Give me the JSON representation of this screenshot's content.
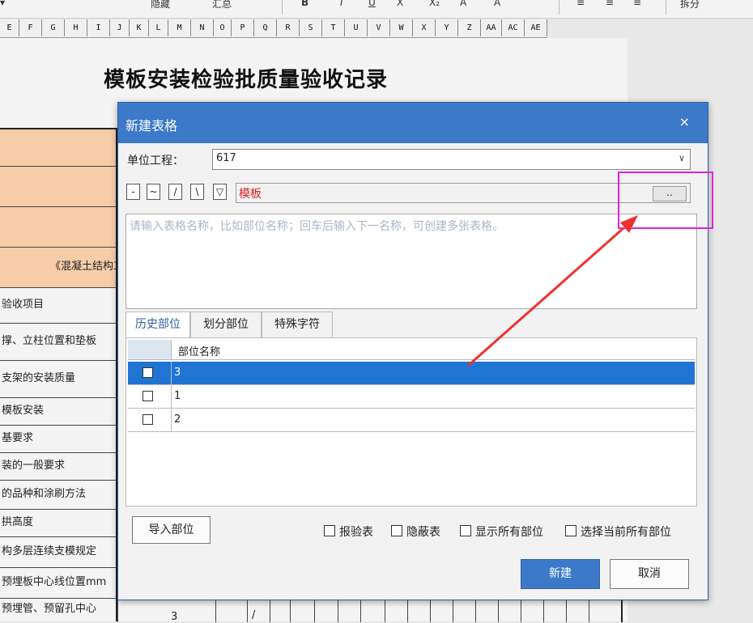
{
  "toolbar": {
    "items": [
      "隐藏",
      "汇总",
      "B",
      "I",
      "U",
      "X",
      "X₂",
      "A",
      "A",
      "拆分"
    ]
  },
  "columns": [
    "E",
    "F",
    "G",
    "H",
    "I",
    "J",
    "K",
    "L",
    "M",
    "N",
    "O",
    "P",
    "Q",
    "R",
    "S",
    "T",
    "U",
    "V",
    "W",
    "X",
    "Y",
    "Z",
    "AA",
    "AC",
    "AE"
  ],
  "sheet": {
    "title": "模板安装检验批质量验收记录",
    "rows": [
      "《混凝土结构工",
      "验收项目",
      "撑、立柱位置和垫板",
      "支架的安装质量",
      "模板安装",
      "基要求",
      "装的一般要求",
      "的品种和涂刷方法",
      "拱高度",
      "构多层连续支模规定",
      "预埋板中心线位置mm",
      "预埋管、预留孔中心"
    ],
    "bottom_values": [
      "3",
      "/"
    ]
  },
  "dialog": {
    "title": "新建表格",
    "close": "×",
    "unit_label": "单位工程：",
    "unit_value": "617",
    "symbols": [
      "-",
      "~",
      "/",
      "\\",
      "▽"
    ],
    "template_value": "模板",
    "browse_label": "..",
    "name_placeholder": "请输入表格名称，比如部位名称；回车后输入下一名称，可创建多张表格。",
    "tabs": [
      "历史部位",
      "划分部位",
      "特殊字符"
    ],
    "table_header": "部位名称",
    "rows": [
      {
        "name": "3",
        "selected": true
      },
      {
        "name": "1",
        "selected": false
      },
      {
        "name": "2",
        "selected": false
      }
    ],
    "import_label": "导入部位",
    "options": [
      "报验表",
      "隐蔽表",
      "显示所有部位",
      "选择当前所有部位"
    ],
    "new_label": "新建",
    "cancel_label": "取消"
  },
  "colors": {
    "title_bar": "#3c79c9",
    "selected_row": "#1f74d4",
    "header_orange": "#f6cda8",
    "annotation": "#e020e0",
    "arrow": "#f03030"
  }
}
